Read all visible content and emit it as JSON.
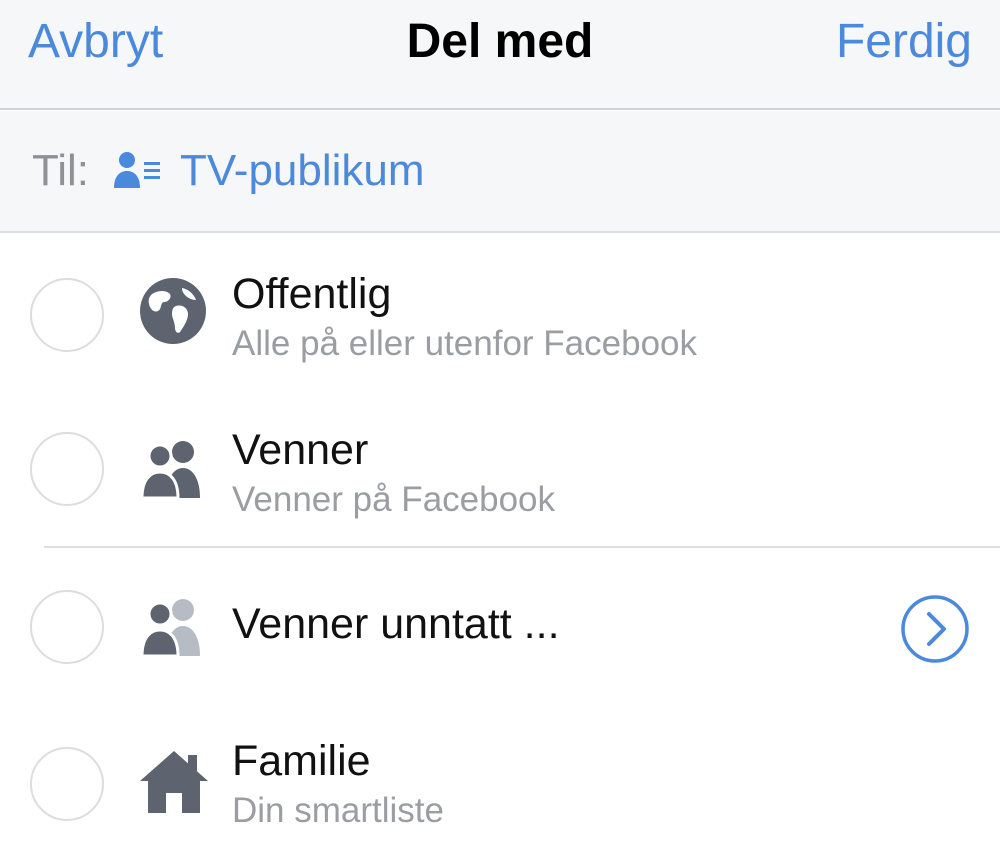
{
  "nav": {
    "cancel_label": "Avbryt",
    "title": "Del med",
    "done_label": "Ferdig"
  },
  "to": {
    "label": "Til:",
    "value": "TV-publikum",
    "icon": "person-list-icon"
  },
  "options": [
    {
      "title": "Offentlig",
      "subtitle": "Alle på eller utenfor Facebook",
      "icon": "globe-icon",
      "selected": false
    },
    {
      "title": "Venner",
      "subtitle": "Venner på Facebook",
      "icon": "friends-icon",
      "selected": false
    },
    {
      "title": "Venner unntatt ...",
      "subtitle": "",
      "icon": "friends-except-icon",
      "selected": false,
      "has_chevron": true
    },
    {
      "title": "Familie",
      "subtitle": "Din smartliste",
      "icon": "house-icon",
      "selected": false
    }
  ],
  "colors": {
    "accent": "#4a89dc",
    "icon_dark": "#5d6470",
    "icon_light": "#b7bcc4",
    "bar_bg": "#f6f7f8"
  }
}
